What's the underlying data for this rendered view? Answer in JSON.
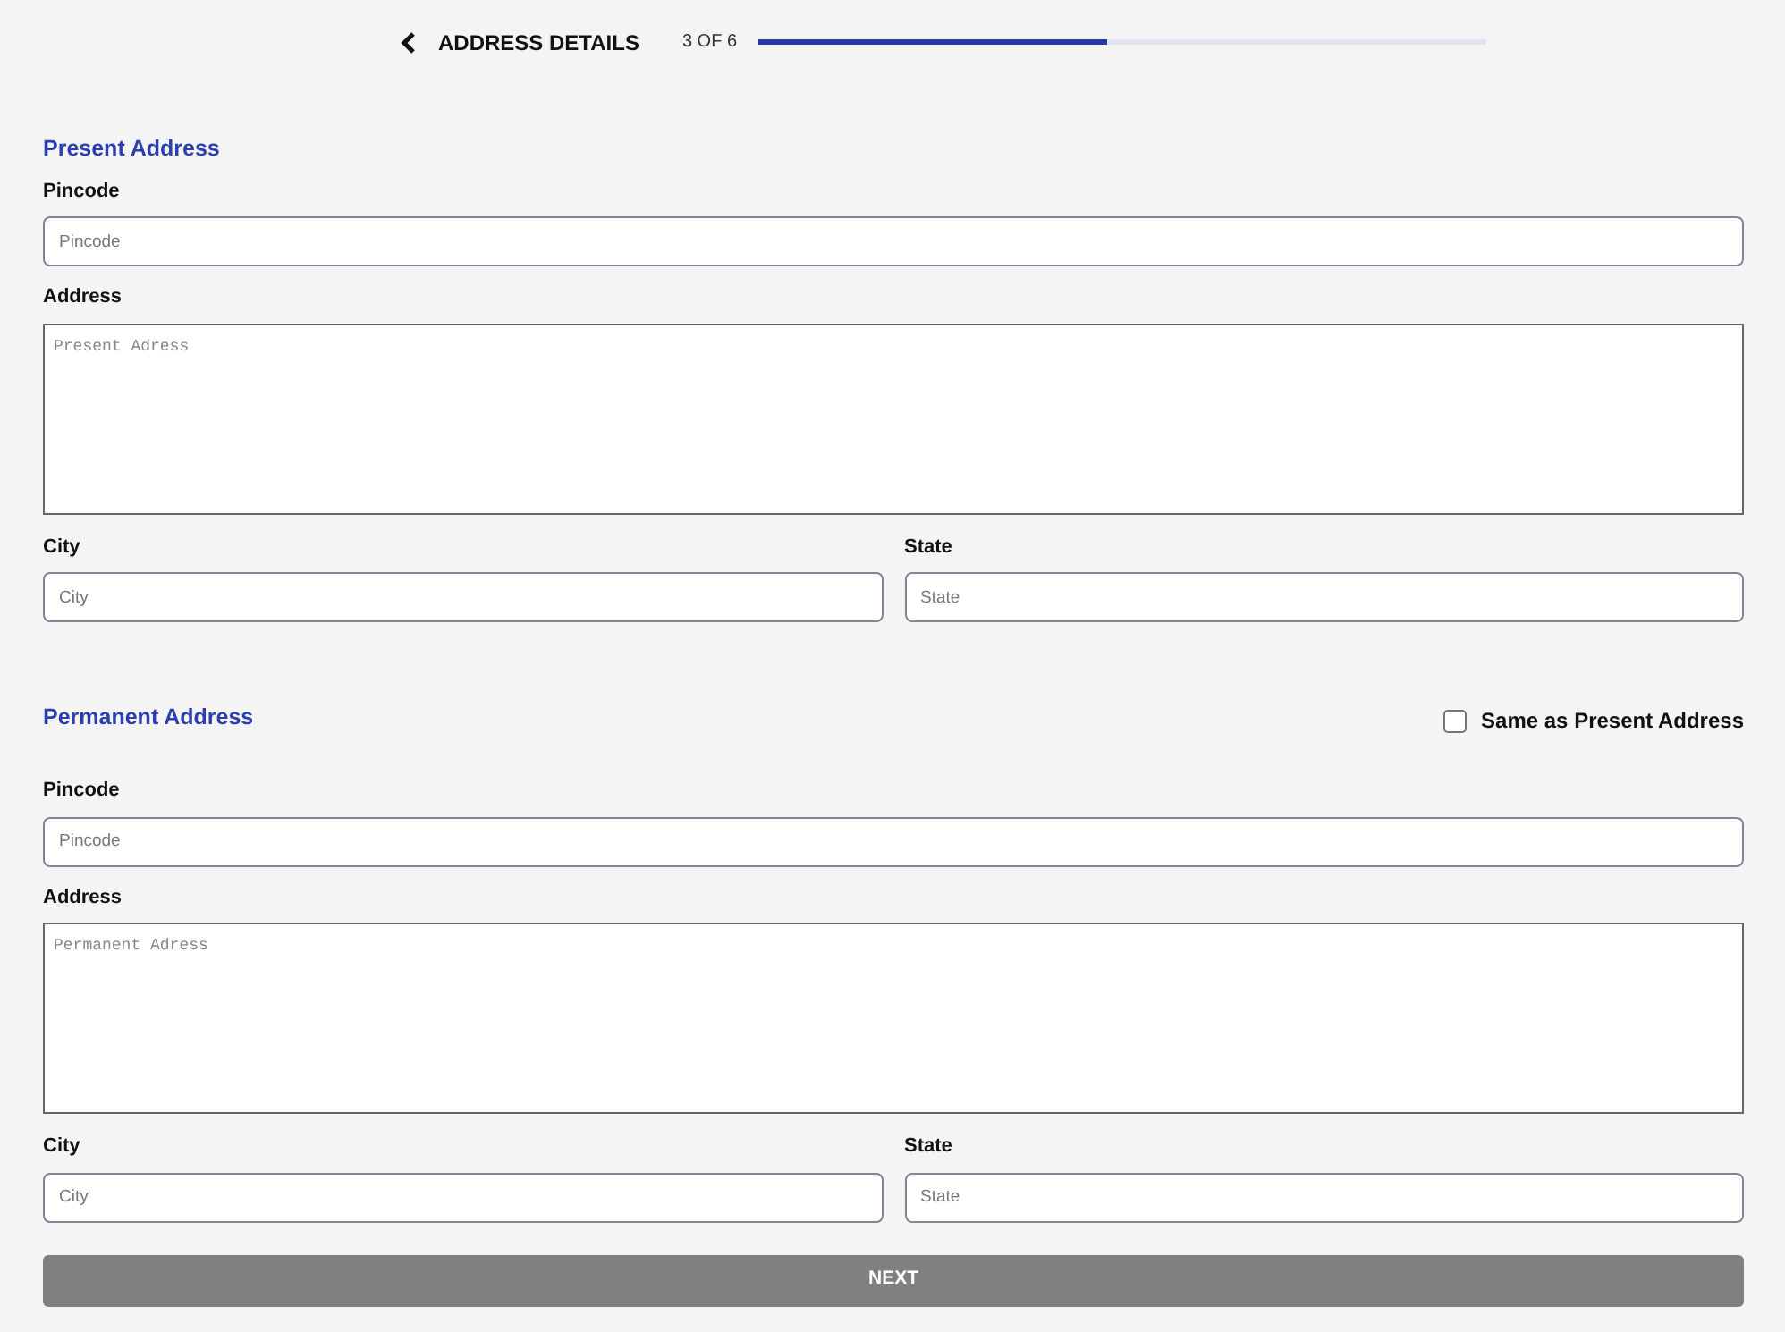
{
  "header": {
    "title": "ADDRESS DETAILS",
    "step": "3 OF 6",
    "level": 0.48
  },
  "sections": [
    {
      "title": "Present Address",
      "pincode": {
        "label": "Pincode",
        "placeholder": "Pincode"
      },
      "address": {
        "label": "Address",
        "placeholder": "Present Adress"
      },
      "city": {
        "label": "City",
        "placeholder": "City"
      },
      "state": {
        "label": "State",
        "placeholder": "State"
      }
    },
    {
      "title": "Permanent Address",
      "same_as": {
        "label": "Same as Present Address",
        "checked": false
      },
      "pincode": {
        "label": "Pincode",
        "placeholder": "Pincode"
      },
      "address": {
        "label": "Address",
        "placeholder": "Permanent Adress"
      },
      "city": {
        "label": "City",
        "placeholder": "City"
      },
      "state": {
        "label": "State",
        "placeholder": "State"
      }
    }
  ],
  "next_button": {
    "label": "NEXT",
    "disabled": true
  }
}
